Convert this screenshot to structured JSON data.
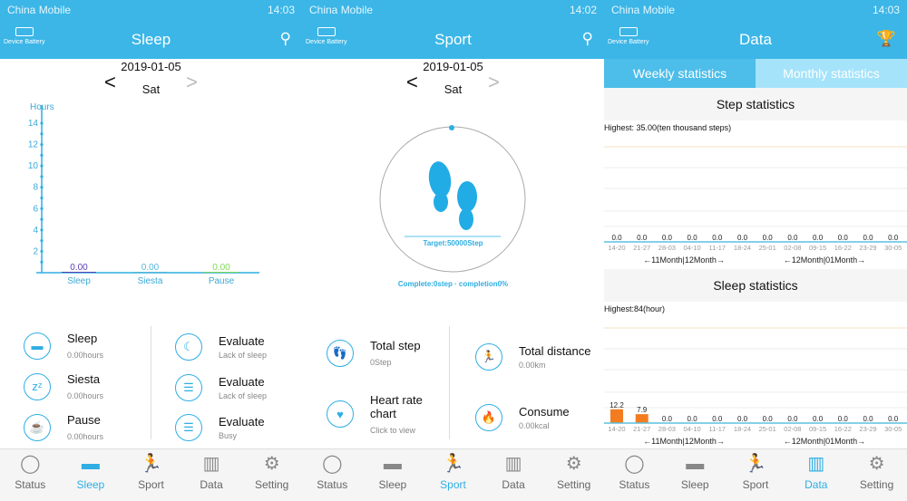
{
  "status_bar": [
    {
      "carrier": "China Mobile",
      "time": "14:03"
    },
    {
      "carrier": "China Mobile",
      "time": "14:02"
    },
    {
      "carrier": "China Mobile",
      "time": "14:03"
    }
  ],
  "header": {
    "battery_label": "Device Battery",
    "titles": [
      "Sleep",
      "Sport",
      "Data"
    ]
  },
  "date": {
    "date": "2019-01-05",
    "weekday": "Sat",
    "prev": "<",
    "next": ">"
  },
  "sleep": {
    "items": [
      {
        "title": "Sleep",
        "value": "0.00hours",
        "icon": "bed-icon"
      },
      {
        "title": "Siesta",
        "value": "0.00hours",
        "icon": "zz-icon"
      },
      {
        "title": "Pause",
        "value": "0.00hours",
        "icon": "cup-icon"
      }
    ],
    "evaluate": [
      {
        "title": "Evaluate",
        "value": "Lack of sleep",
        "icon": "moon-list-icon"
      },
      {
        "title": "Evaluate",
        "value": "Lack of sleep",
        "icon": "sun-list-icon"
      },
      {
        "title": "Evaluate",
        "value": "Busy",
        "icon": "list-icon"
      }
    ]
  },
  "sport": {
    "target": "Target:50000Step",
    "complete": "Complete:0step · completion0%",
    "progress_percent": 0,
    "items": [
      {
        "title": "Total step",
        "value": "0Step",
        "icon": "footsteps-icon"
      },
      {
        "title": "Heart rate chart",
        "value": "Click to view",
        "icon": "heart-icon"
      },
      {
        "title": "Total distance",
        "value": "0.00km",
        "icon": "runner-icon"
      },
      {
        "title": "Consume",
        "value": "0.00kcal",
        "icon": "flame-icon"
      }
    ]
  },
  "data_screen": {
    "tabs": [
      "Weekly statistics",
      "Monthly statistics"
    ],
    "active_tab": 0,
    "step_title": "Step statistics",
    "step_highest": "Highest:  35.00(ten thousand steps)",
    "sleep_title": "Sleep statistics",
    "sleep_highest": "Highest:84(hour)",
    "month_labels": [
      "←11Month|12Month→",
      "←12Month|01Month→"
    ]
  },
  "tabbar": {
    "items": [
      "Status",
      "Sleep",
      "Sport",
      "Data",
      "Setting"
    ]
  },
  "colors": {
    "accent": "#3bb6e7",
    "bar": "#f47c20",
    "sleep_value": "#5b3fb5",
    "siesta_value": "#56b8d8",
    "pause_value": "#7ed957"
  },
  "chart_data": [
    {
      "type": "bar",
      "ylabel": "Hours",
      "categories": [
        "Sleep",
        "Siesta",
        "Pause"
      ],
      "values": [
        0.0,
        0.0,
        0.0
      ],
      "labels": [
        "0.00",
        "0.00",
        "0.00"
      ],
      "yticks": [
        "2",
        "4",
        "6",
        "8",
        "10",
        "12",
        "14"
      ],
      "ylim": [
        0,
        15
      ]
    },
    {
      "type": "bar",
      "title": "Step statistics",
      "categories": [
        "14-20",
        "21-27",
        "28-03",
        "04-10",
        "11-17",
        "18-24",
        "25-01",
        "02-08",
        "09-15",
        "16-22",
        "23-29",
        "30-05"
      ],
      "values": [
        0,
        0,
        0,
        0,
        0,
        0,
        0,
        0,
        0,
        0,
        0,
        0
      ],
      "labels": [
        "0.0",
        "0.0",
        "0.0",
        "0.0",
        "0.0",
        "0.0",
        "0.0",
        "0.0",
        "0.0",
        "0.0",
        "0.0",
        "0.0"
      ],
      "ylim": [
        0,
        35
      ]
    },
    {
      "type": "bar",
      "title": "Sleep statistics",
      "categories": [
        "14-20",
        "21-27",
        "28-03",
        "04-10",
        "11-17",
        "18-24",
        "25-01",
        "02-08",
        "09-15",
        "16-22",
        "23-29",
        "30-05"
      ],
      "values": [
        12.2,
        7.9,
        0,
        0,
        0,
        0,
        0,
        0,
        0,
        0,
        0,
        0
      ],
      "labels": [
        "12.2",
        "7.9",
        "0.0",
        "0.0",
        "0.0",
        "0.0",
        "0.0",
        "0.0",
        "0.0",
        "0.0",
        "0.0",
        "0.0"
      ],
      "ylim": [
        0,
        84
      ]
    }
  ]
}
